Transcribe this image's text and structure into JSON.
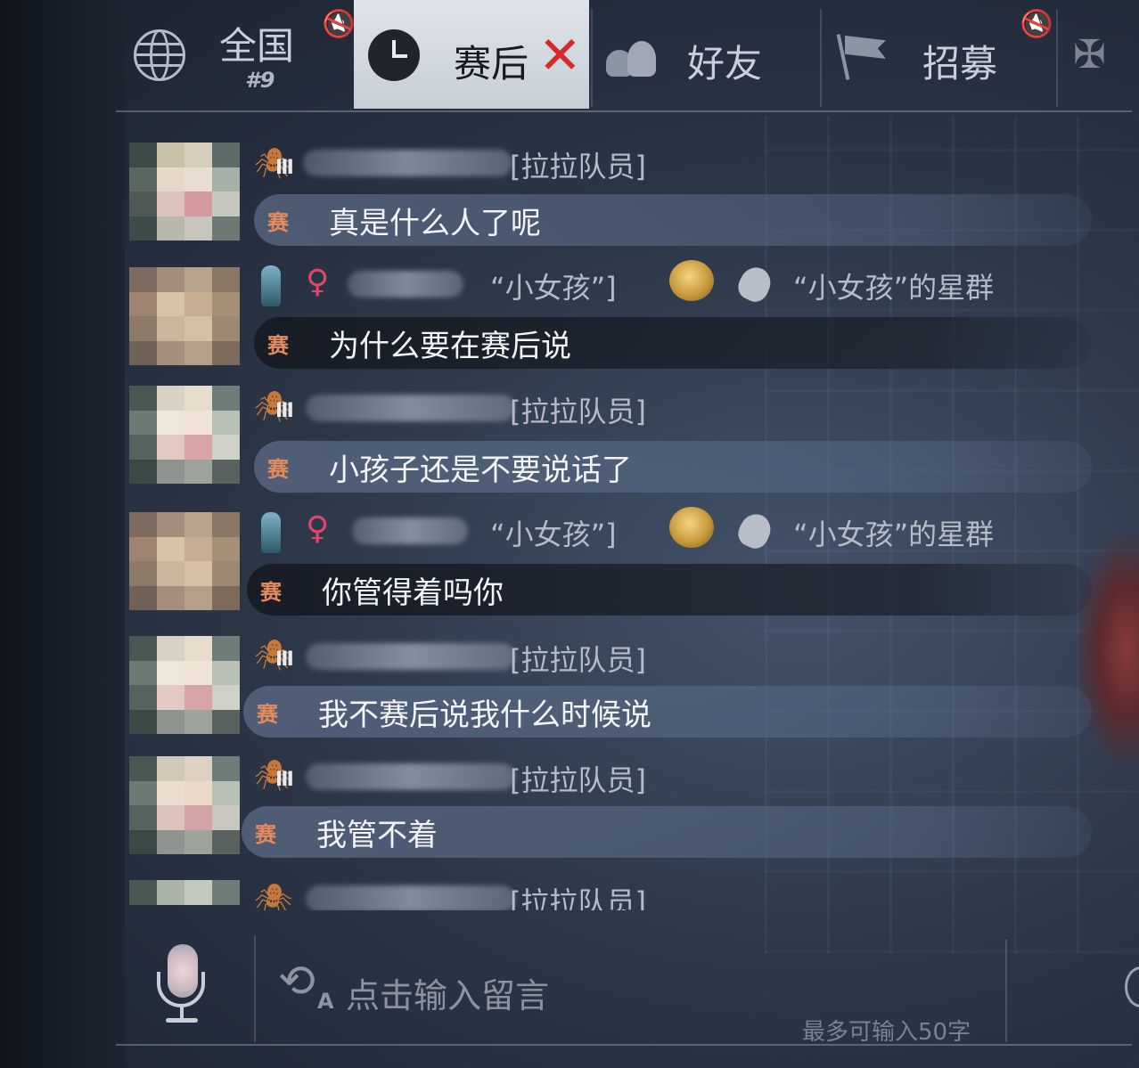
{
  "tabs": [
    {
      "id": "global",
      "label": "全国",
      "rank": "#9",
      "icon": "globe-icon",
      "selected": false
    },
    {
      "id": "after",
      "label": "赛后",
      "icon": "clock-icon",
      "selected": true
    },
    {
      "id": "friends",
      "label": "好友",
      "icon": "friends-icon",
      "selected": false
    },
    {
      "id": "recruit",
      "label": "招募",
      "icon": "flag-icon",
      "selected": false
    },
    {
      "id": "more",
      "label": "",
      "icon": "crossed-flags-icon",
      "selected": false
    }
  ],
  "messages": [
    {
      "title": "[拉拉队员]",
      "badge": "spider-rank-badge",
      "channel": "赛",
      "text": "真是什么人了呢",
      "style": "light"
    },
    {
      "title": "“小女孩”]",
      "badge": "blue-figure-badge",
      "gender": "♀",
      "group": "“小女孩”的星群",
      "channel": "赛",
      "text": "为什么要在赛后说",
      "style": "dark"
    },
    {
      "title": "[拉拉队员]",
      "badge": "spider-rank-badge",
      "channel": "赛",
      "text": "小孩子还是不要说话了",
      "style": "light"
    },
    {
      "title": "“小女孩”]",
      "badge": "blue-figure-badge",
      "gender": "♀",
      "group": "“小女孩”的星群",
      "channel": "赛",
      "text": "你管得着吗你",
      "style": "dark"
    },
    {
      "title": "[拉拉队员]",
      "badge": "spider-rank-badge",
      "channel": "赛",
      "text": "我不赛后说我什么时候说",
      "style": "light"
    },
    {
      "title": "[拉拉队员]",
      "badge": "spider-rank-badge",
      "channel": "赛",
      "text": "我管不着",
      "style": "light"
    },
    {
      "title": "[拉拉队员]",
      "badge": "spider-rank-badge",
      "channel": "",
      "text": "",
      "style": "none"
    }
  ],
  "input": {
    "placeholder": "点击输入留言",
    "limit": "最多可输入50字"
  },
  "colors": {
    "accent_red": "#d52a2a",
    "female_pink": "#e0466a",
    "channel_orange": "#e48a5d",
    "selected_tab": "#d7dce3"
  }
}
